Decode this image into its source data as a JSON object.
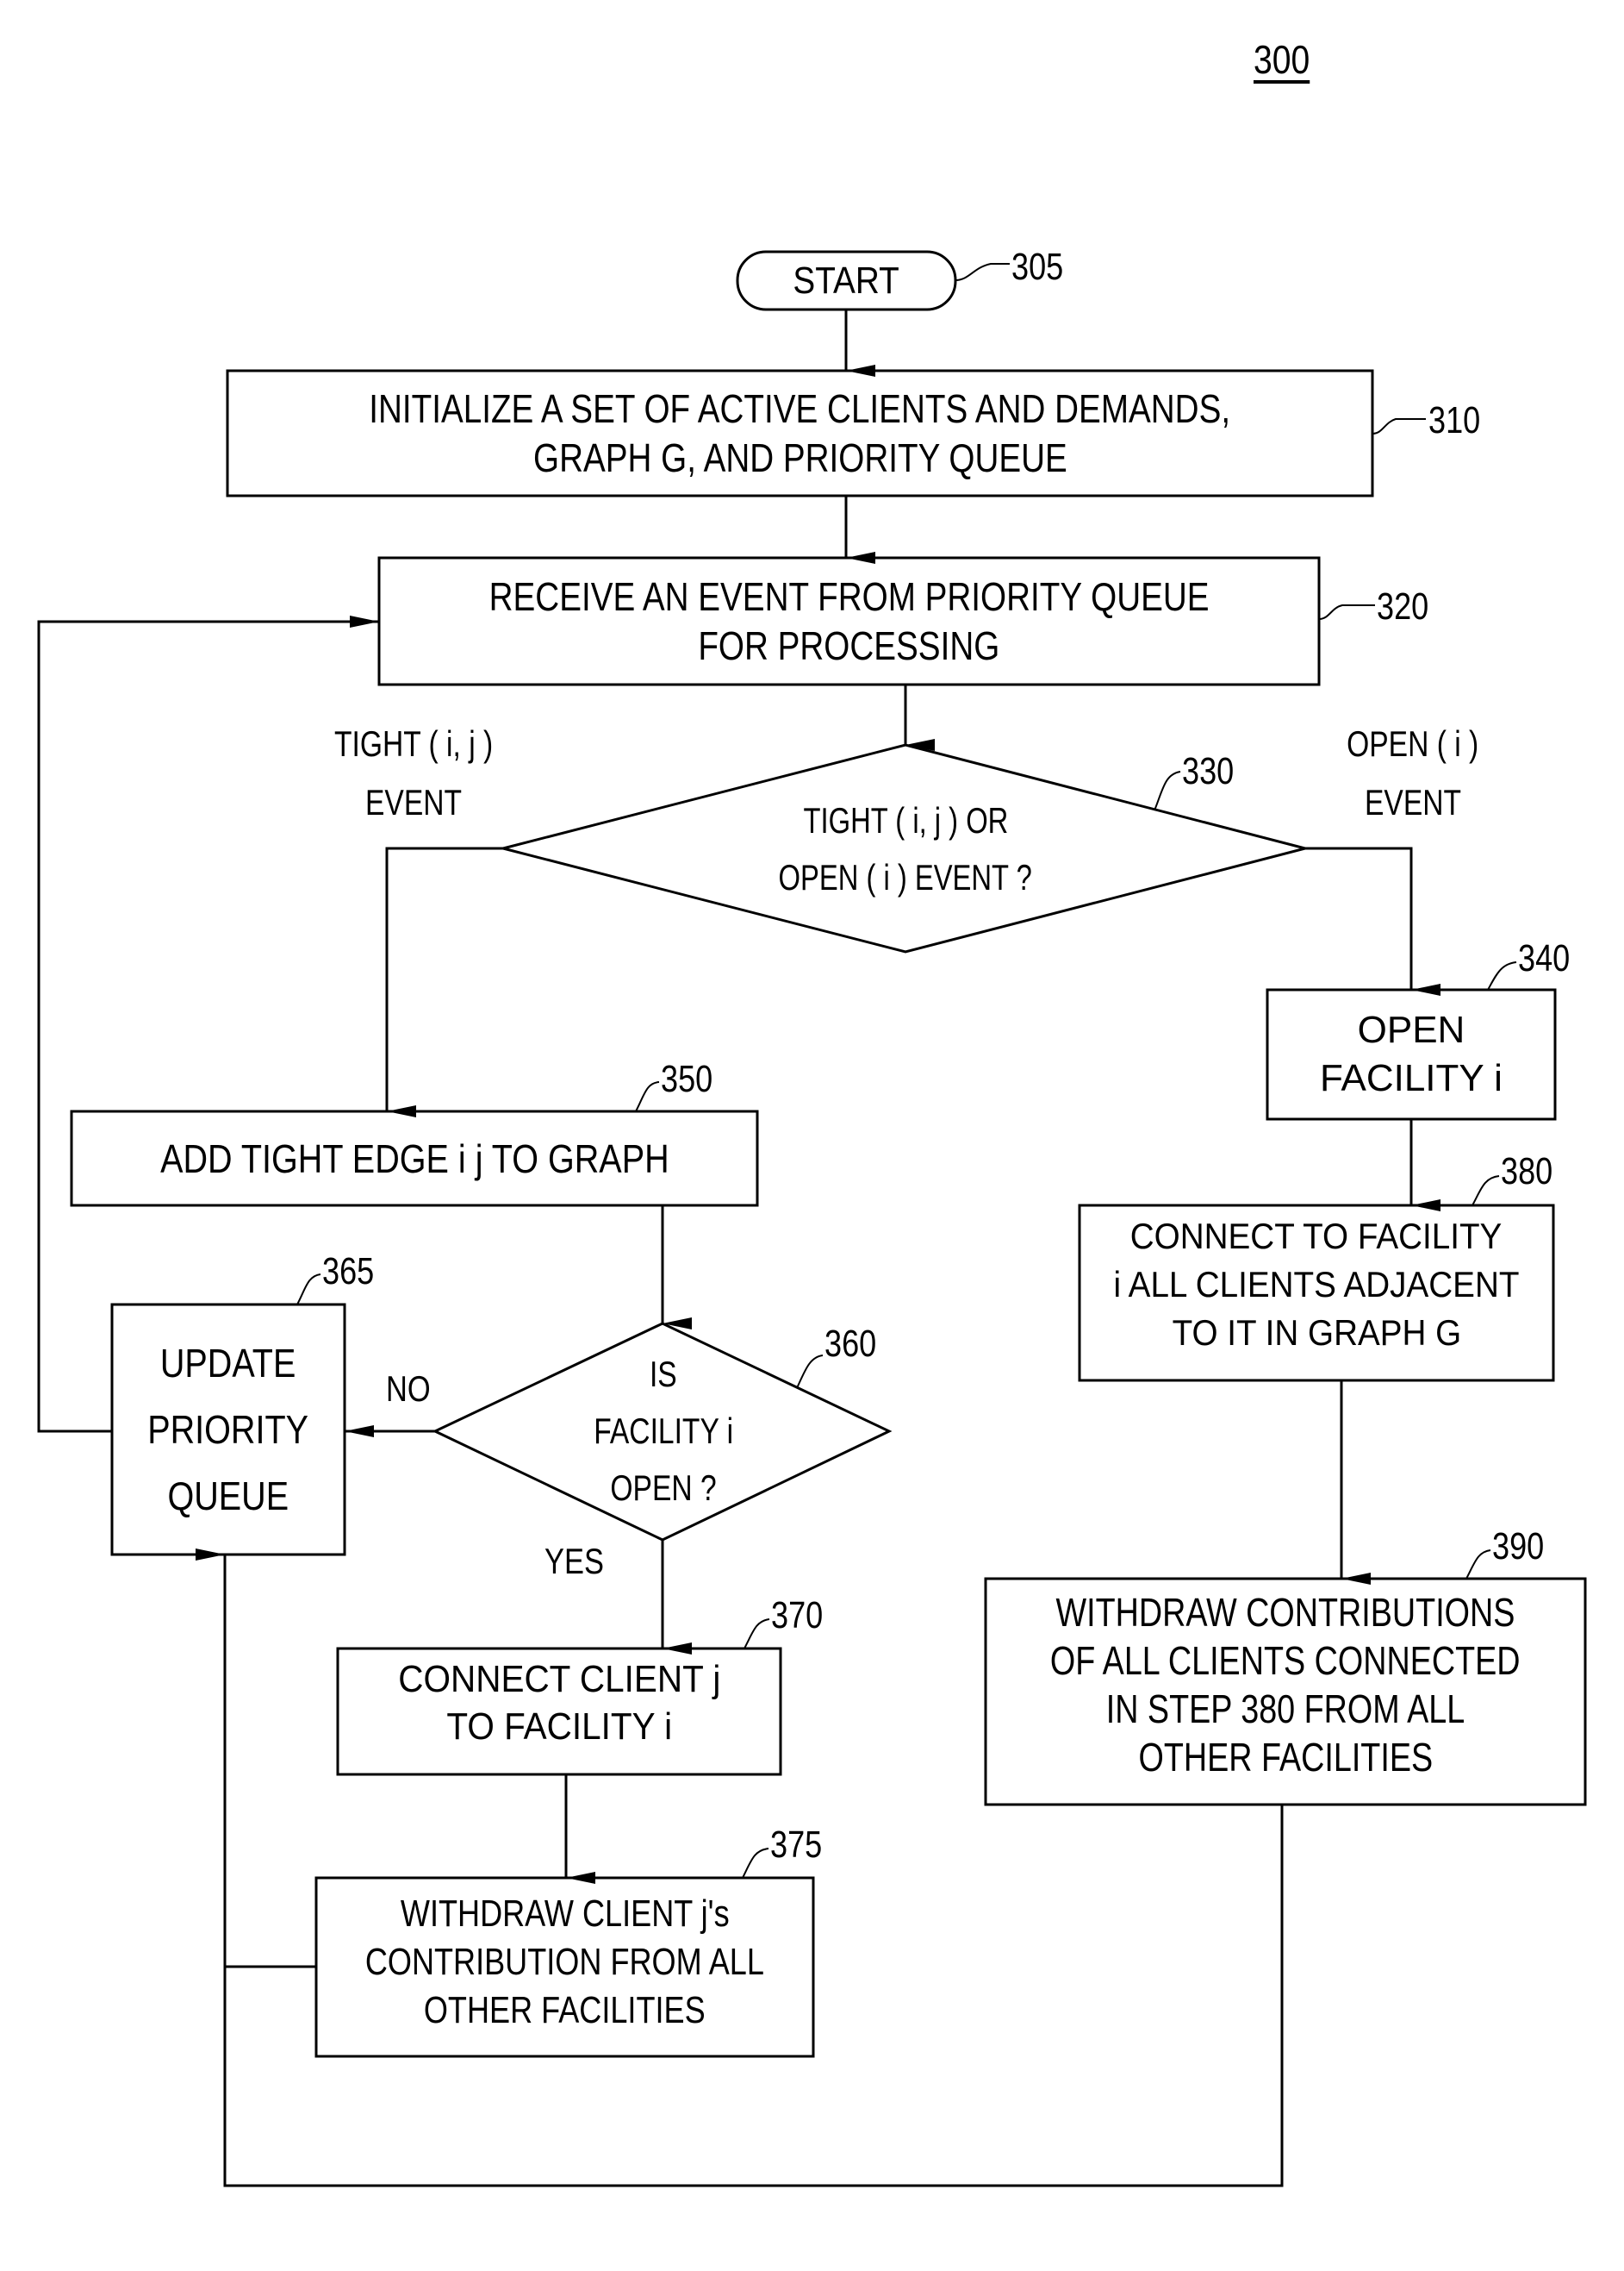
{
  "figure": {
    "number": "300"
  },
  "nodes": {
    "start": {
      "ref": "305",
      "lines": [
        "START"
      ]
    },
    "init": {
      "ref": "310",
      "lines": [
        "INITIALIZE A SET OF ACTIVE CLIENTS AND DEMANDS,",
        "GRAPH G, AND PRIORITY QUEUE"
      ]
    },
    "receive": {
      "ref": "320",
      "lines": [
        "RECEIVE AN EVENT FROM PRIORITY QUEUE",
        "FOR PROCESSING"
      ]
    },
    "decision_event": {
      "ref": "330",
      "lines": [
        "TIGHT ( i,  j ) OR",
        "OPEN ( i ) EVENT ?"
      ]
    },
    "open_facility": {
      "ref": "340",
      "lines": [
        "OPEN",
        "FACILITY  i"
      ]
    },
    "add_edge": {
      "ref": "350",
      "lines": [
        "ADD TIGHT EDGE  i j  TO GRAPH"
      ]
    },
    "decision_open": {
      "ref": "360",
      "lines": [
        "IS",
        "FACILITY  i",
        "OPEN ?"
      ]
    },
    "update_queue": {
      "ref": "365",
      "lines": [
        "UPDATE",
        "PRIORITY",
        "QUEUE"
      ]
    },
    "connect_client": {
      "ref": "370",
      "lines": [
        "CONNECT CLIENT  j",
        "TO FACILITY  i"
      ]
    },
    "withdraw_client": {
      "ref": "375",
      "lines": [
        "WITHDRAW CLIENT  j's",
        "CONTRIBUTION FROM ALL",
        "OTHER FACILITIES"
      ]
    },
    "connect_all": {
      "ref": "380",
      "lines": [
        "CONNECT TO FACILITY",
        "i  ALL CLIENTS ADJACENT",
        "TO IT IN GRAPH G"
      ]
    },
    "withdraw_all": {
      "ref": "390",
      "lines": [
        "WITHDRAW CONTRIBUTIONS",
        "OF ALL CLIENTS CONNECTED",
        "IN STEP 380 FROM ALL",
        "OTHER FACILITIES"
      ]
    }
  },
  "edge_labels": {
    "tight_event": [
      "TIGHT ( i,  j )",
      "EVENT"
    ],
    "open_event": [
      "OPEN ( i )",
      "EVENT"
    ],
    "no": "NO",
    "yes": "YES"
  }
}
